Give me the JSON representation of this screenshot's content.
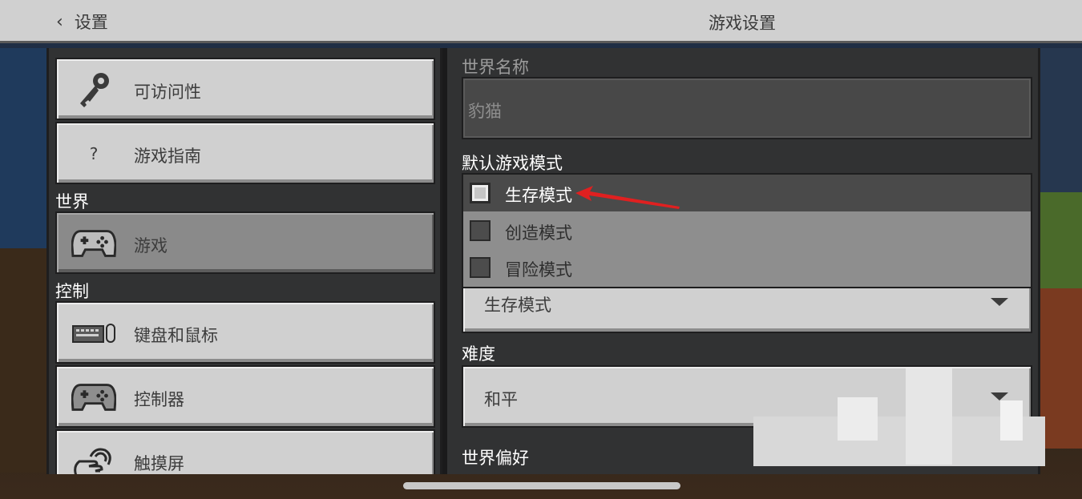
{
  "header": {
    "back_label": "设置",
    "title": "游戏设置"
  },
  "sidebar": {
    "items": [
      {
        "label": "可访问性",
        "icon": "key-icon"
      },
      {
        "label": "游戏指南",
        "icon": "question-icon"
      }
    ],
    "icon_question_glyph": "?",
    "section_world": "世界",
    "world_items": [
      {
        "label": "游戏",
        "icon": "gamepad-icon",
        "active": true
      }
    ],
    "section_controls": "控制",
    "control_items": [
      {
        "label": "键盘和鼠标",
        "icon": "keyboard-mouse-icon"
      },
      {
        "label": "控制器",
        "icon": "controller-icon"
      },
      {
        "label": "触摸屏",
        "icon": "touch-icon"
      }
    ]
  },
  "main": {
    "world_name_label": "世界名称",
    "world_name_value": "豹猫",
    "game_mode_label": "默认游戏模式",
    "game_mode_options": [
      {
        "label": "生存模式",
        "selected": true
      },
      {
        "label": "创造模式",
        "selected": false
      },
      {
        "label": "冒险模式",
        "selected": false
      }
    ],
    "game_mode_value": "生存模式",
    "difficulty_label": "难度",
    "difficulty_value": "和平",
    "world_prefs_label": "世界偏好"
  },
  "colors": {
    "button_light": "#d0d0d0",
    "button_active": "#8a8a8a",
    "panel_bg": "#313233",
    "annotation_red": "#e02020"
  }
}
